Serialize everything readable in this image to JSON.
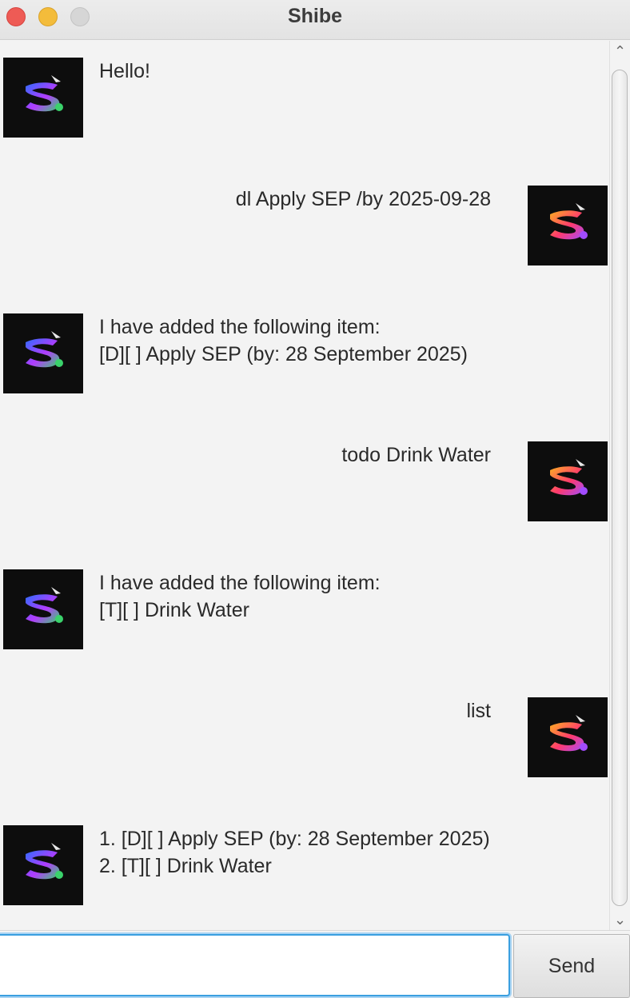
{
  "window": {
    "title": "Shibe"
  },
  "messages": [
    {
      "sender": "bot",
      "lines": "Hello!"
    },
    {
      "sender": "user",
      "lines": "dl Apply SEP /by 2025-09-28"
    },
    {
      "sender": "bot",
      "lines": "I have added the following item:\n[D][ ] Apply SEP (by: 28 September 2025)"
    },
    {
      "sender": "user",
      "lines": "todo Drink Water"
    },
    {
      "sender": "bot",
      "lines": "I have added the following item:\n[T][ ] Drink Water"
    },
    {
      "sender": "user",
      "lines": "list"
    },
    {
      "sender": "bot",
      "lines": "1. [D][ ] Apply SEP (by: 28 September 2025)\n2. [T][ ] Drink Water"
    }
  ],
  "input": {
    "value": "",
    "send_label": "Send"
  },
  "colors": {
    "accent": "#3a9fe0",
    "avatar_background": "#0d0d0d",
    "bot_avatar_gradient": [
      "#2f6bff",
      "#b23cff",
      "#3ad26b"
    ],
    "user_avatar_gradient": [
      "#ffb020",
      "#ff3a6e",
      "#a24cff"
    ]
  },
  "icons": {
    "bot_avatar": "bot-avatar-icon",
    "user_avatar": "user-avatar-icon"
  }
}
